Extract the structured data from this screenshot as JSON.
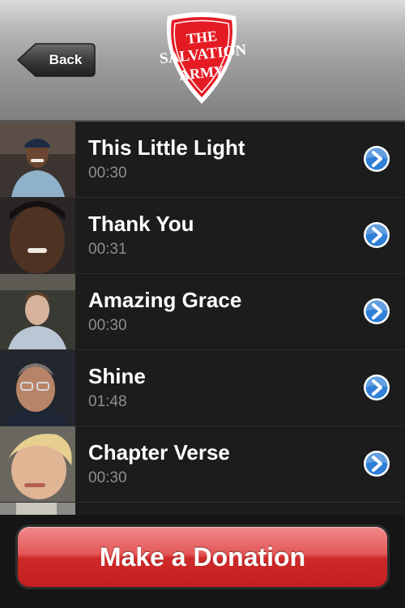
{
  "header": {
    "back_label": "Back",
    "logo": {
      "line1": "THE",
      "line2": "SALVATION",
      "line3": "ARMY",
      "color": "#e51b24"
    }
  },
  "videos": [
    {
      "title": "This Little Light",
      "duration": "00:30"
    },
    {
      "title": "Thank You",
      "duration": "00:31"
    },
    {
      "title": "Amazing Grace",
      "duration": "00:30"
    },
    {
      "title": "Shine",
      "duration": "01:48"
    },
    {
      "title": "Chapter Verse",
      "duration": "00:30"
    }
  ],
  "footer": {
    "donate_label": "Make a Donation",
    "button_color": "#d93a3a"
  },
  "colors": {
    "accent_blue": "#2f7fd6",
    "list_bg": "#1c1c1c",
    "duration_text": "#8d8d8d"
  }
}
